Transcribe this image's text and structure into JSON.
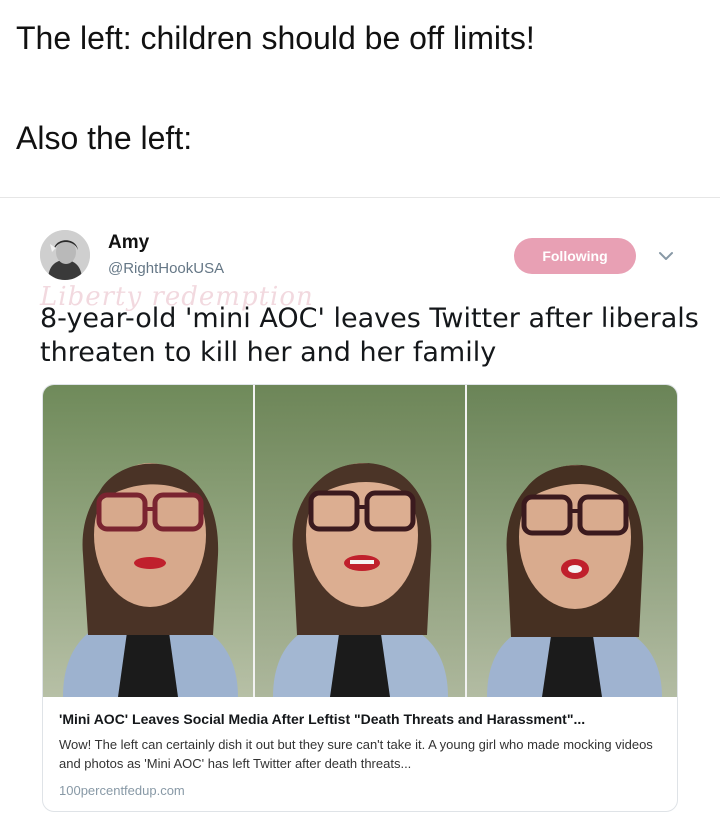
{
  "caption": {
    "line1": "The left: children should be off limits!",
    "line2": "Also the left:"
  },
  "tweet": {
    "author": {
      "display_name": "Amy",
      "handle": "@RightHookUSA",
      "avatar_icon": "profile-photo"
    },
    "follow_button_label": "Following",
    "menu_icon": "chevron-down-icon",
    "watermark": "Liberty redemption",
    "text": "8-year-old 'mini AOC' leaves Twitter after liberals threaten to kill her and her family",
    "card": {
      "title": "'Mini AOC' Leaves Social Media After Leftist \"Death Threats and Harassment\"...",
      "description": "Wow! The left can certainly dish it out but they sure can't take it. A young girl who made mocking videos and photos as 'Mini AOC' has left Twitter after death threats...",
      "domain": "100percentfedup.com",
      "image_panels": [
        "girl-photo-1",
        "girl-photo-2",
        "girl-photo-3"
      ]
    }
  },
  "colors": {
    "follow_button": "#e8a0b4",
    "handle": "#657786",
    "card_border": "#dfe3e7"
  }
}
